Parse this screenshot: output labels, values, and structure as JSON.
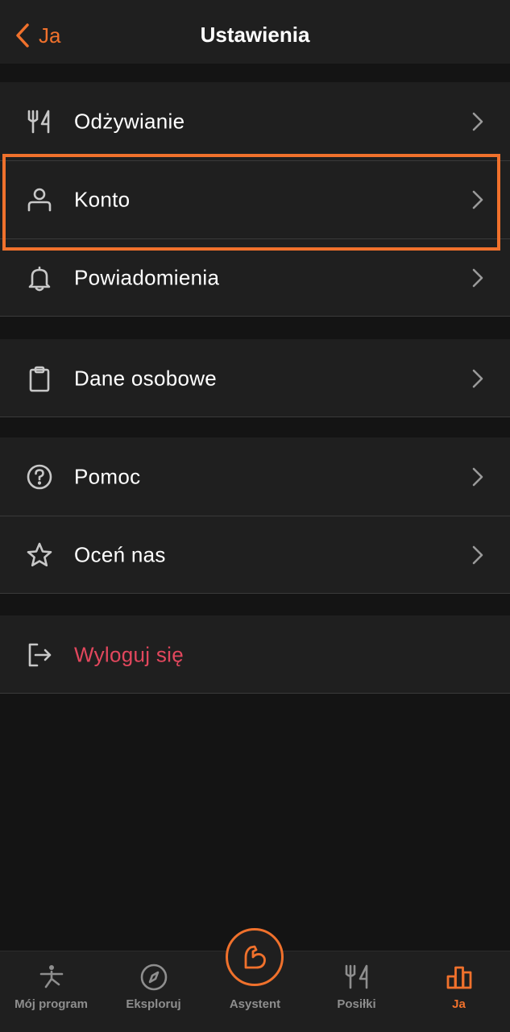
{
  "header": {
    "back_label": "Ja",
    "title": "Ustawienia"
  },
  "groups": [
    {
      "items": [
        {
          "label": "Odżywianie",
          "icon": "fork-knife-icon"
        },
        {
          "label": "Konto",
          "icon": "person-icon"
        },
        {
          "label": "Powiadomienia",
          "icon": "bell-icon"
        }
      ]
    },
    {
      "items": [
        {
          "label": "Dane osobowe",
          "icon": "clipboard-icon"
        }
      ]
    },
    {
      "items": [
        {
          "label": "Pomoc",
          "icon": "question-circle-icon"
        },
        {
          "label": "Oceń nas",
          "icon": "star-icon"
        }
      ]
    },
    {
      "items": [
        {
          "label": "Wyloguj się",
          "icon": "logout-icon"
        }
      ]
    }
  ],
  "highlighted_item": "Konto",
  "tabbar": {
    "tabs": [
      {
        "label": "Mój program",
        "icon": "yoga-pose-icon"
      },
      {
        "label": "Eksploruj",
        "icon": "compass-icon"
      },
      {
        "label": "Asystent",
        "icon": "flexed-arm-icon"
      },
      {
        "label": "Posiłki",
        "icon": "fork-knife-icon"
      },
      {
        "label": "Ja",
        "icon": "bar-chart-icon",
        "active": true
      }
    ]
  },
  "colors": {
    "accent": "#f0712c",
    "danger": "#e2475d",
    "background": "#141414",
    "surface": "#1f1f1f",
    "text": "#ffffff",
    "muted": "#8e8e8e"
  }
}
